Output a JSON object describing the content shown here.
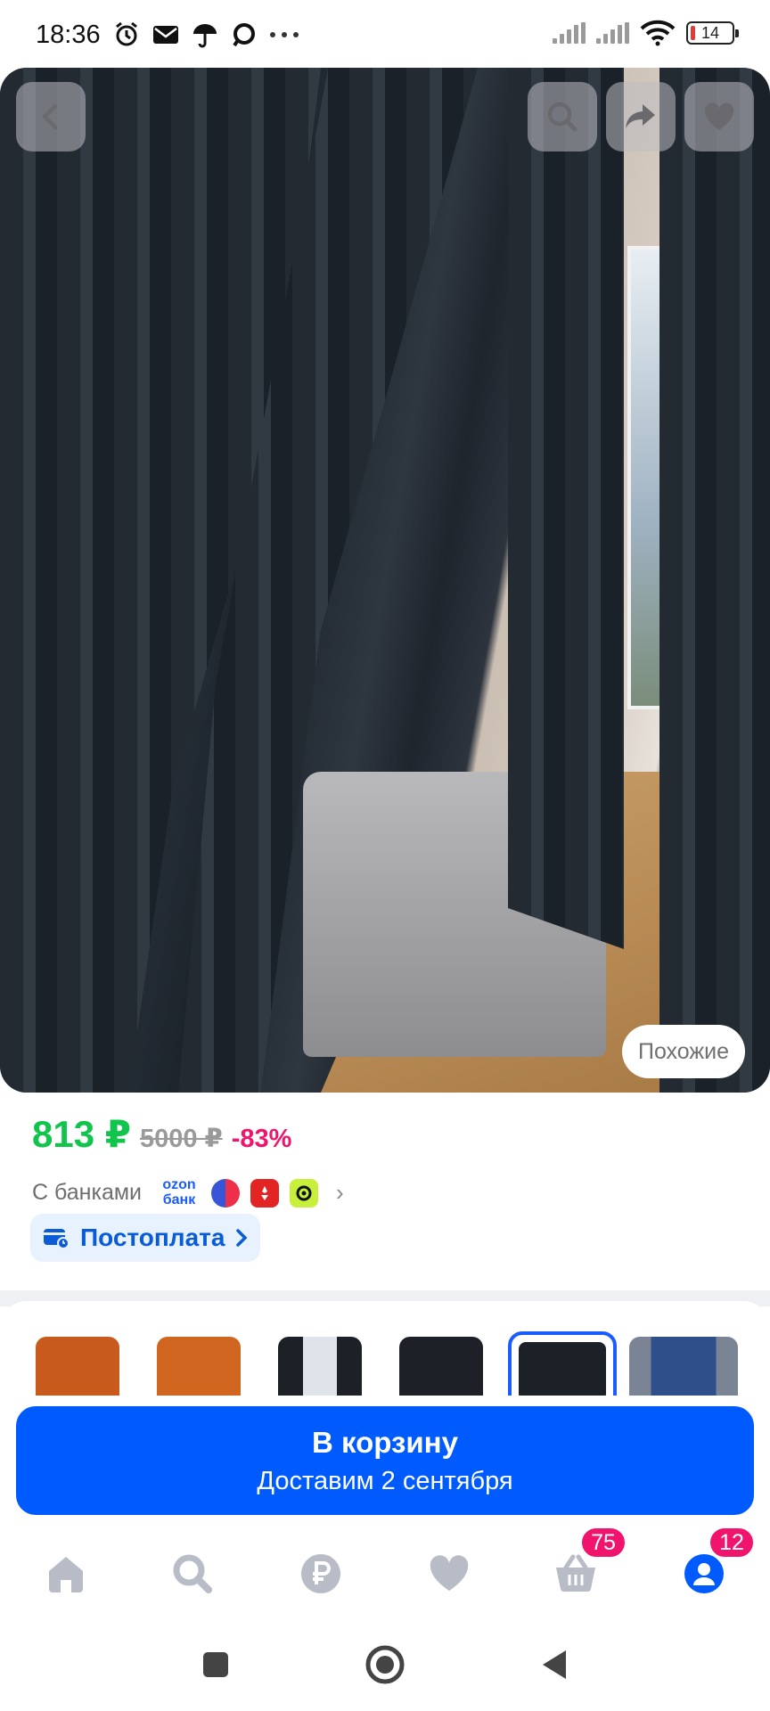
{
  "status_bar": {
    "time": "18:36",
    "icons": [
      "alarm-icon",
      "mail-icon",
      "umbrella-icon",
      "chat-icon",
      "more-icon"
    ],
    "battery": "14"
  },
  "hero": {
    "similar_label": "Похожие",
    "buttons": [
      "back-icon",
      "search-icon",
      "share-icon",
      "heart-icon"
    ]
  },
  "product": {
    "price": "813 ₽",
    "old_price": "5000 ₽",
    "discount": "-83%",
    "banks_label": "С банками",
    "ozon_bank_logo": "ozon банк",
    "postpay_label": "Постоплата"
  },
  "variants": {
    "colors": [
      "#c85a1e",
      "#d0651f",
      "#8a8f96",
      "#1d2127",
      "#1c2128",
      "#2f4f8a"
    ],
    "selected_index": 4
  },
  "cart": {
    "title": "В корзину",
    "subtitle": "Доставим 2 сентября"
  },
  "bottom_nav": {
    "items": [
      "home-icon",
      "search-icon",
      "ruble-icon",
      "favorites-icon",
      "cart-icon",
      "profile-icon"
    ],
    "cart_badge": "75",
    "profile_badge": "12"
  },
  "colors": {
    "accent": "#005bff",
    "price": "#10c44c",
    "discount": "#f0146c",
    "nav_icon": "#b7bcc6"
  }
}
